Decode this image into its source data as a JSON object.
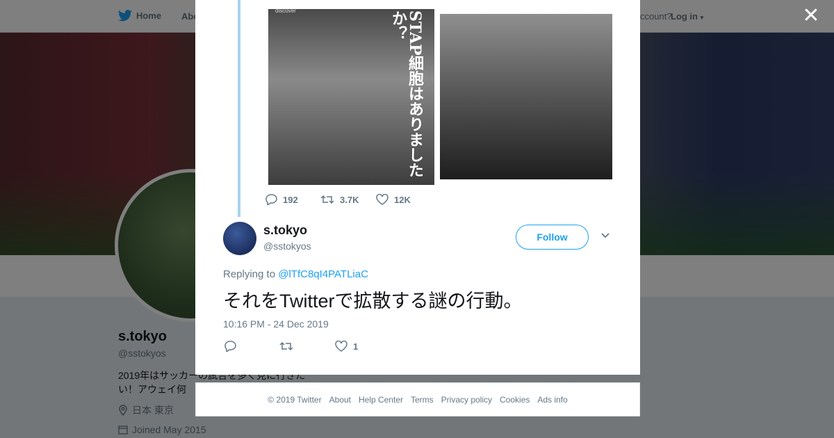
{
  "nav": {
    "home": "Home",
    "about": "Abo",
    "account": "ccount?",
    "login": "Log in"
  },
  "profile": {
    "name": "s.tokyo",
    "handle": "@sstokyos",
    "bio": "2019年はサッカーの試合を多く見に行きたい！アウェイ何",
    "location": "日本 東京",
    "joined": "Joined May 2015"
  },
  "quoted_photos": {
    "caption": "STAP細胞はありましたか？",
    "brand": "discover"
  },
  "top_actions": {
    "replies": "192",
    "retweets": "3.7K",
    "likes": "12K"
  },
  "tweet": {
    "name": "s.tokyo",
    "handle": "@sstokyos",
    "follow": "Follow",
    "replying_prefix": "Replying to",
    "replying_to": "@lTfC8qI4PATLiaC",
    "text": "それをTwitterで拡散する謎の行動。",
    "time": "10:16 PM - 24 Dec 2019",
    "likes": "1"
  },
  "footer": {
    "links": [
      "© 2019 Twitter",
      "About",
      "Help Center",
      "Terms",
      "Privacy policy",
      "Cookies",
      "Ads info"
    ]
  },
  "colors": {
    "accent": "#1da1f2",
    "muted": "#657786",
    "thread": "#a8d3ee"
  }
}
